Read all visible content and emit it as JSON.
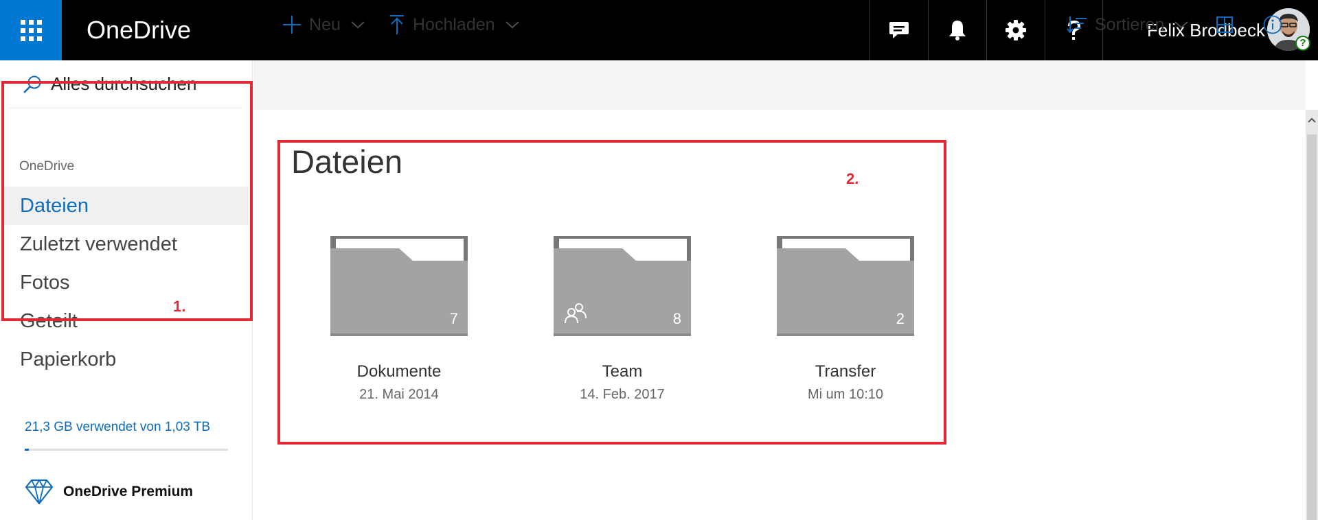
{
  "app": {
    "title": "OneDrive"
  },
  "user": {
    "name": "Felix Brodbeck",
    "presence_badge": "?"
  },
  "search": {
    "label": "Alles durchsuchen"
  },
  "nav": {
    "heading": "OneDrive",
    "items": [
      {
        "label": "Dateien",
        "active": true
      },
      {
        "label": "Zuletzt verwendet"
      },
      {
        "label": "Fotos"
      },
      {
        "label": "Geteilt"
      },
      {
        "label": "Papierkorb"
      }
    ]
  },
  "storage": {
    "text": "21,3 GB verwendet von 1,03 TB",
    "used_percent": 2
  },
  "premium": {
    "label": "OneDrive Premium"
  },
  "toolbar": {
    "new_label": "Neu",
    "upload_label": "Hochladen",
    "sort_label": "Sortieren"
  },
  "main": {
    "title": "Dateien",
    "folders": [
      {
        "name": "Dokumente",
        "date": "21. Mai 2014",
        "count": "7",
        "shared": false
      },
      {
        "name": "Team",
        "date": "14. Feb. 2017",
        "count": "8",
        "shared": true
      },
      {
        "name": "Transfer",
        "date": "Mi um 10:10",
        "count": "2",
        "shared": false
      }
    ]
  },
  "annotations": {
    "box1": "1.",
    "box2": "2."
  },
  "colors": {
    "accent": "#0078d4",
    "link": "#0f6cbd",
    "annotation": "#e02a36",
    "topbar": "#000000"
  },
  "icons": [
    "waffle-icon",
    "feedback-icon",
    "bell-icon",
    "gear-icon",
    "help-icon",
    "search-icon",
    "plus-icon",
    "upload-icon",
    "sort-icon",
    "grid-view-icon",
    "info-icon",
    "diamond-icon",
    "folder-icon",
    "shared-people-icon"
  ]
}
